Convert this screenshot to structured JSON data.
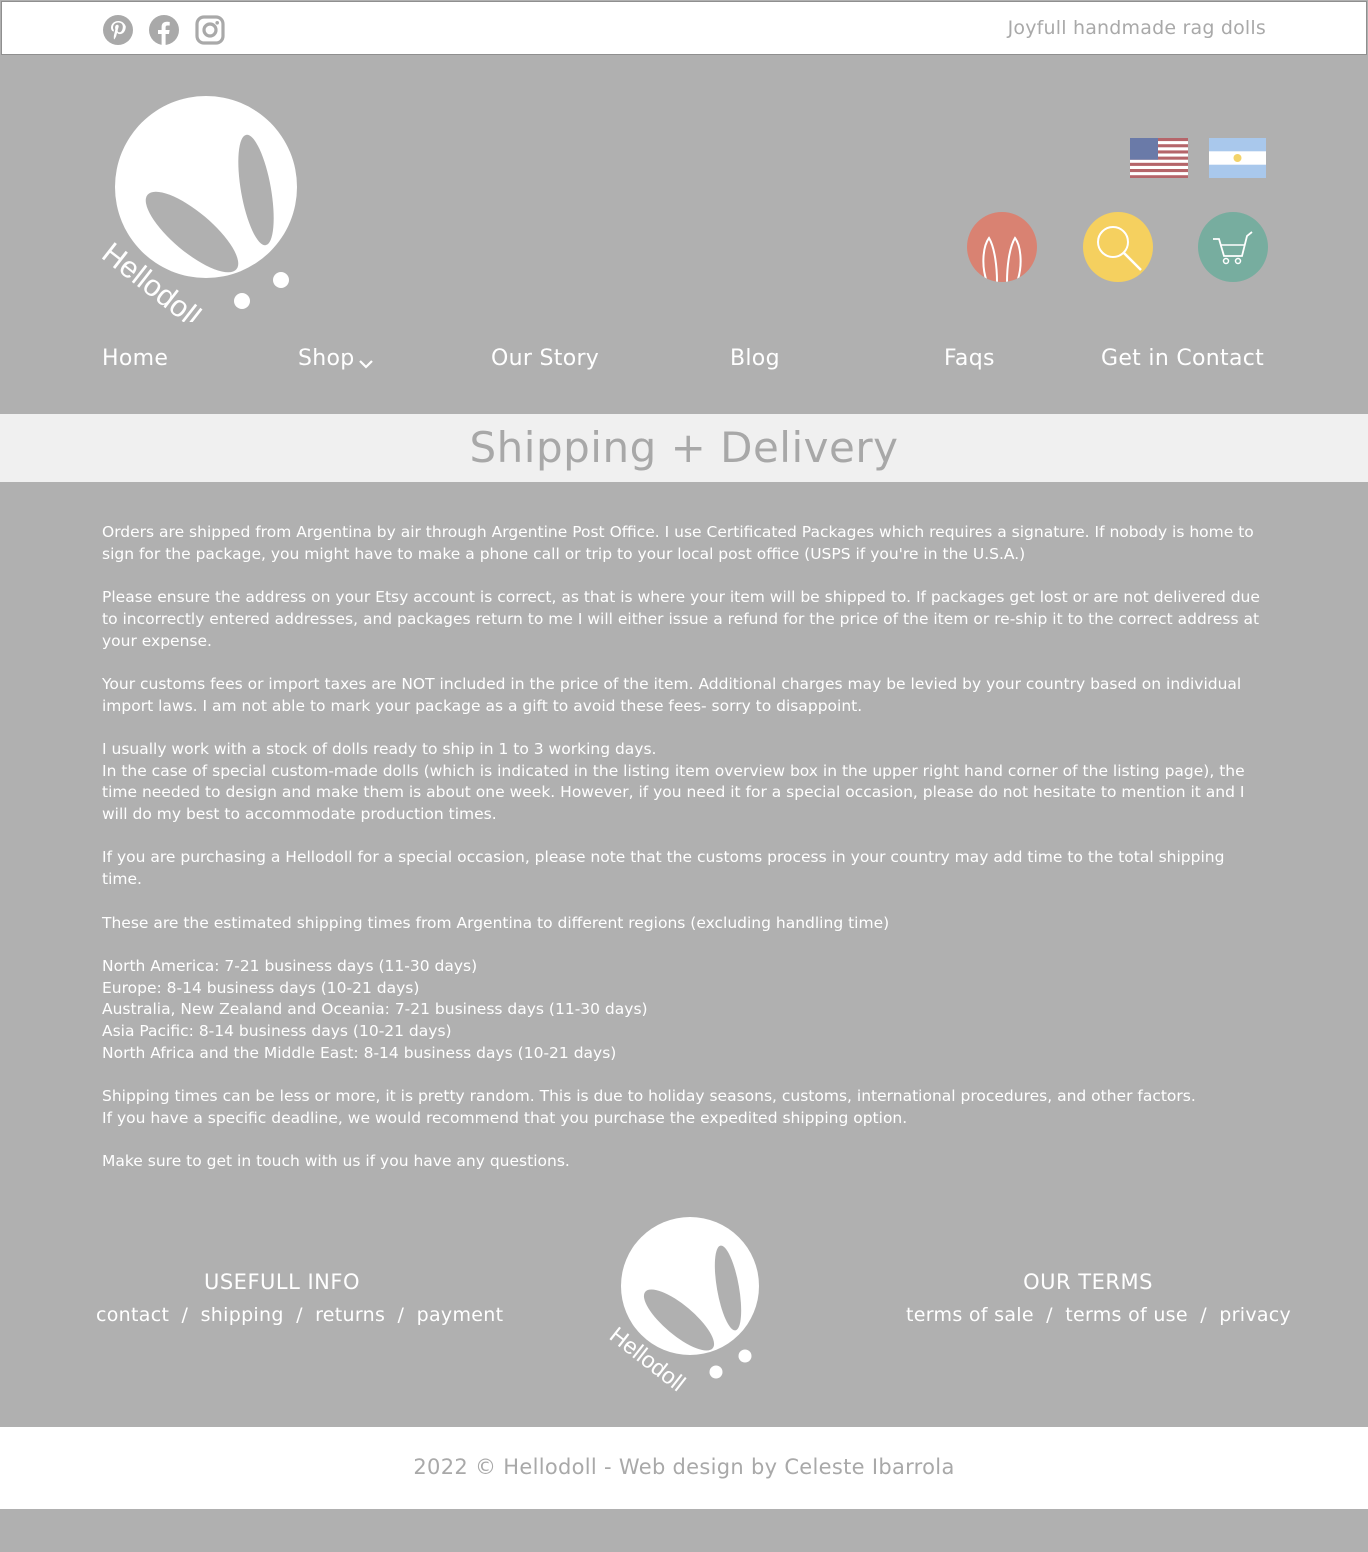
{
  "header": {
    "tagline": "Joyfull handmade rag dolls",
    "social_icons": [
      "pinterest-icon",
      "facebook-icon",
      "instagram-icon"
    ],
    "logo_text": "Hellodoll",
    "flags": [
      "usa-flag",
      "argentina-flag"
    ],
    "action_icons": [
      {
        "icon": "bunny-ears-icon",
        "color": "#d98272"
      },
      {
        "icon": "search-icon",
        "color": "#f5d05f"
      },
      {
        "icon": "cart-icon",
        "color": "#77ad9f"
      }
    ]
  },
  "nav": {
    "home": "Home",
    "shop": "Shop",
    "story": "Our Story",
    "blog": "Blog",
    "faqs": "Faqs",
    "contact": "Get in Contact"
  },
  "page": {
    "title": "Shipping + Delivery",
    "paragraphs": [
      [
        "Orders are shipped from Argentina by air through Argentine Post Office. I use Certificated Packages which requires a signature. If nobody is home to sign for the package, you might have to make a phone call or trip to your local post office (USPS if you're in the U.S.A.)"
      ],
      [
        "Please ensure the address on your Etsy account is correct, as that is where your item will be shipped to. If packages get lost or are not delivered due to incorrectly entered addresses, and packages return to me I will either issue a refund for the price of the item or re-ship it to the correct address at your expense."
      ],
      [
        "Your customs fees or import taxes are NOT included in the price of the item. Additional charges may be levied by your country based on individual import laws. I am not able to mark your package as a gift to avoid these fees- sorry to disappoint."
      ],
      [
        "I usually work with a stock of dolls ready to ship in 1 to 3 working days.",
        "In the case of special custom-made dolls (which is indicated in the listing item overview box in the upper right hand corner of the listing page), the time needed to design and make them is about one week. However, if you need it for a special occasion, please do not hesitate to mention it and I will do my best to accommodate production times."
      ],
      [
        "If you are purchasing a Hellodoll for a special occasion, please note that the customs process in your country may add time to the total shipping time."
      ],
      [
        "These are the estimated shipping times from Argentina to different regions (excluding handling time)"
      ],
      [
        "North America: 7-21 business days (11-30 days)",
        "Europe: 8-14 business days (10-21 days)",
        "Australia, New Zealand and Oceania: 7-21 business days (11-30 days)",
        "Asia Pacific: 8-14 business days (10-21 days)",
        "North Africa and the Middle East: 8-14 business days (10-21 days)"
      ],
      [
        "Shipping times can be less or more, it is pretty random. This is due to holiday seasons, customs, international procedures, and other factors.",
        "If you have a specific deadline, we would recommend that you purchase the expedited shipping option."
      ],
      [
        "Make sure to get in touch with us if you have any questions."
      ]
    ]
  },
  "footer": {
    "useful_heading": "USEFULL INFO",
    "useful_links": [
      "contact",
      "shipping",
      "returns",
      "payment"
    ],
    "terms_heading": "OUR TERMS",
    "terms_links": [
      "terms of sale",
      "terms of use",
      "privacy"
    ],
    "separator": "/",
    "logo_text": "Hellodoll",
    "copyright": "2022 © Hellodoll - Web design by Celeste Ibarrola"
  }
}
